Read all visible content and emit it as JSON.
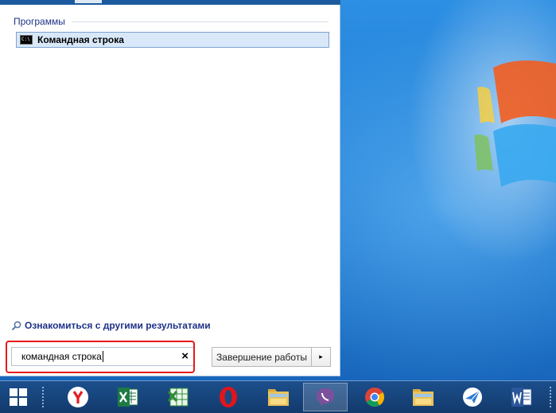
{
  "start_menu": {
    "section_title": "Программы",
    "result_item": {
      "label": "Командная строка",
      "icon": "cmd-icon"
    },
    "more_results": "Ознакомиться с другими результатами",
    "search": {
      "value": "командная строка",
      "clear_symbol": "×"
    },
    "shutdown": {
      "label": "Завершение работы",
      "arrow": "▸"
    }
  },
  "taskbar": {
    "items": [
      {
        "name": "yandex-browser",
        "icon": "yandex-icon"
      },
      {
        "name": "excel",
        "icon": "excel-icon"
      },
      {
        "name": "spreadsheet",
        "icon": "spreadsheet-icon"
      },
      {
        "name": "opera",
        "icon": "opera-icon"
      },
      {
        "name": "file-explorer",
        "icon": "folder-icon"
      },
      {
        "name": "viber",
        "icon": "viber-icon"
      },
      {
        "name": "chrome",
        "icon": "chrome-icon"
      },
      {
        "name": "file-explorer-2",
        "icon": "folder-icon"
      },
      {
        "name": "messenger",
        "icon": "messenger-icon"
      },
      {
        "name": "word",
        "icon": "word-icon"
      }
    ]
  },
  "colors": {
    "accent": "#1e3287",
    "highlight_border": "#e51a1a",
    "taskbar": "#123a6d",
    "desktop": "#1a76cf"
  }
}
